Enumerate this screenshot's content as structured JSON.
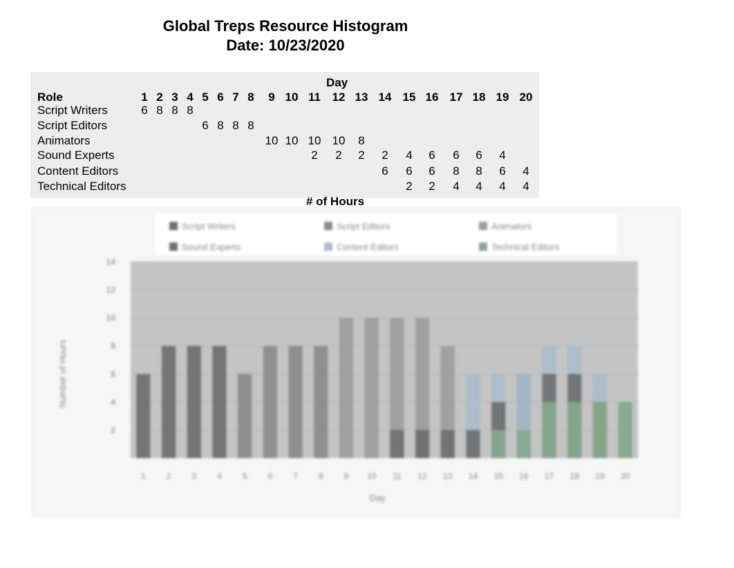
{
  "header": {
    "title": "Global Treps Resource Histogram",
    "date": "Date: 10/23/2020"
  },
  "table": {
    "day_header": "Day",
    "role_header": "Role",
    "days": [
      "1",
      "2",
      "3",
      "4",
      "5",
      "6",
      "7",
      "8",
      "9",
      "10",
      "11",
      "12",
      "13",
      "14",
      "15",
      "16",
      "17",
      "18",
      "19",
      "20"
    ],
    "rows": [
      {
        "role": "Script Writers",
        "values": [
          "6",
          "8",
          "8",
          "8",
          "",
          "",
          "",
          "",
          "",
          "",
          "",
          "",
          "",
          "",
          "",
          "",
          "",
          "",
          "",
          ""
        ]
      },
      {
        "role": "Script Editors",
        "values": [
          "",
          "",
          "",
          "",
          "6",
          "8",
          "8",
          "8",
          "",
          "",
          "",
          "",
          "",
          "",
          "",
          "",
          "",
          "",
          "",
          ""
        ]
      },
      {
        "role": "Animators",
        "values": [
          "",
          "",
          "",
          "",
          "",
          "",
          "",
          "",
          "10",
          "10",
          "10",
          "10",
          "8",
          "",
          "",
          "",
          "",
          "",
          "",
          ""
        ]
      },
      {
        "role": "Sound Experts",
        "values": [
          "",
          "",
          "",
          "",
          "",
          "",
          "",
          "",
          "",
          "",
          "2",
          "2",
          "2",
          "2",
          "4",
          "6",
          "6",
          "6",
          "4",
          ""
        ]
      },
      {
        "role": "Content Editors",
        "values": [
          "",
          "",
          "",
          "",
          "",
          "",
          "",
          "",
          "",
          "",
          "",
          "",
          "",
          "6",
          "6",
          "6",
          "8",
          "8",
          "6",
          "4"
        ]
      },
      {
        "role": "Technical Editors",
        "values": [
          "",
          "",
          "",
          "",
          "",
          "",
          "",
          "",
          "",
          "",
          "",
          "",
          "",
          "",
          "2",
          "2",
          "4",
          "4",
          "4",
          "4"
        ]
      }
    ],
    "footer": "# of Hours"
  },
  "chart_data": {
    "type": "bar",
    "title": "",
    "xlabel": "Day",
    "ylabel": "Number of Hours",
    "categories": [
      "1",
      "2",
      "3",
      "4",
      "5",
      "6",
      "7",
      "8",
      "9",
      "10",
      "11",
      "12",
      "13",
      "14",
      "15",
      "16",
      "17",
      "18",
      "19",
      "20"
    ],
    "ylim": [
      0,
      14
    ],
    "yticks": [
      "2",
      "4",
      "6",
      "8",
      "10",
      "12",
      "14"
    ],
    "grid": true,
    "legend": "top",
    "series": [
      {
        "name": "Script Writers",
        "color": "#6e6e6e",
        "values": [
          6,
          8,
          8,
          8,
          0,
          0,
          0,
          0,
          0,
          0,
          0,
          0,
          0,
          0,
          0,
          0,
          0,
          0,
          0,
          0
        ]
      },
      {
        "name": "Script Editors",
        "color": "#8a8a8a",
        "values": [
          0,
          0,
          0,
          0,
          6,
          8,
          8,
          8,
          0,
          0,
          0,
          0,
          0,
          0,
          0,
          0,
          0,
          0,
          0,
          0
        ]
      },
      {
        "name": "Animators",
        "color": "#9c9c9c",
        "values": [
          0,
          0,
          0,
          0,
          0,
          0,
          0,
          0,
          10,
          10,
          10,
          10,
          8,
          0,
          0,
          0,
          0,
          0,
          0,
          0
        ]
      },
      {
        "name": "Sound Experts",
        "color": "#6f6f6f",
        "values": [
          0,
          0,
          0,
          0,
          0,
          0,
          0,
          0,
          0,
          0,
          2,
          2,
          2,
          2,
          4,
          6,
          6,
          6,
          4,
          0
        ]
      },
      {
        "name": "Content Editors",
        "color": "#a9bccb",
        "values": [
          0,
          0,
          0,
          0,
          0,
          0,
          0,
          0,
          0,
          0,
          0,
          0,
          0,
          6,
          6,
          6,
          8,
          8,
          6,
          4
        ]
      },
      {
        "name": "Technical Editors",
        "color": "#86a88e",
        "values": [
          0,
          0,
          0,
          0,
          0,
          0,
          0,
          0,
          0,
          0,
          0,
          0,
          0,
          0,
          2,
          2,
          4,
          4,
          4,
          4
        ]
      }
    ]
  }
}
